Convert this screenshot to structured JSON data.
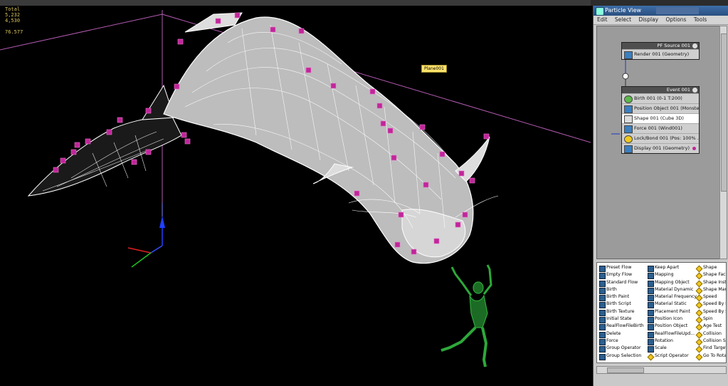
{
  "viewport": {
    "stats": [
      "Total",
      "5,232",
      "4,530",
      "",
      "76.577"
    ],
    "plane_label": "Plane001"
  },
  "particle_view": {
    "title": "Particle View",
    "menu": [
      "Edit",
      "Select",
      "Display",
      "Options",
      "Tools"
    ],
    "source_node": {
      "title": "PF Source 001",
      "operators": [
        {
          "label": "Render 001 (Geometry)",
          "icon": "render-icon"
        }
      ]
    },
    "event_node": {
      "title": "Event 001",
      "operators": [
        {
          "label": "Birth 001 (0-1 T:200)",
          "icon": "birth-icon"
        },
        {
          "label": "Position Object 001 (Monste...",
          "icon": "position-object-icon"
        },
        {
          "label": "Shape 001 (Cube 3D)",
          "icon": "shape-icon",
          "selected": true
        },
        {
          "label": "Force 001 (Wind001)",
          "icon": "force-icon"
        },
        {
          "label": "Lock/Bond 001 (Pos: 100% ...",
          "icon": "lock-bond-icon"
        },
        {
          "label": "Display 001 (Geometry)",
          "icon": "display-icon",
          "has_dot": true
        }
      ]
    },
    "depot": {
      "col1": [
        "Preset Flow",
        "Empty Flow",
        "Standard Flow",
        "Birth",
        "Birth Paint",
        "Birth Script",
        "Birth Texture",
        "Initial State",
        "RealFlowFileBirth",
        "Delete",
        "Force",
        "Group Operator",
        "Group Selection"
      ],
      "col2": [
        "Keep Apart",
        "Mapping",
        "Mapping Object",
        "Material Dynamic",
        "Material Frequency",
        "Material Static",
        "Placement Paint",
        "Position Icon",
        "Position Object",
        "RealFlowFileUpd...",
        "Rotation",
        "Scale",
        "Script Operator"
      ],
      "col2_test_index": [
        12
      ],
      "col3": [
        "Shape",
        "Shape Facing",
        "Shape Instance",
        "Shape Mark",
        "Speed",
        "Speed By Icon",
        "Speed By Surface",
        "Spin",
        "Age Test",
        "Collision",
        "Collision Spawn",
        "Find Target",
        "Go To Rotation"
      ],
      "col3_test_from": 0
    }
  },
  "colors": {
    "mesh": "#ffffff",
    "cubes": "#c0269a",
    "figure": "#2ea83a",
    "plane": "#b25ab0"
  }
}
